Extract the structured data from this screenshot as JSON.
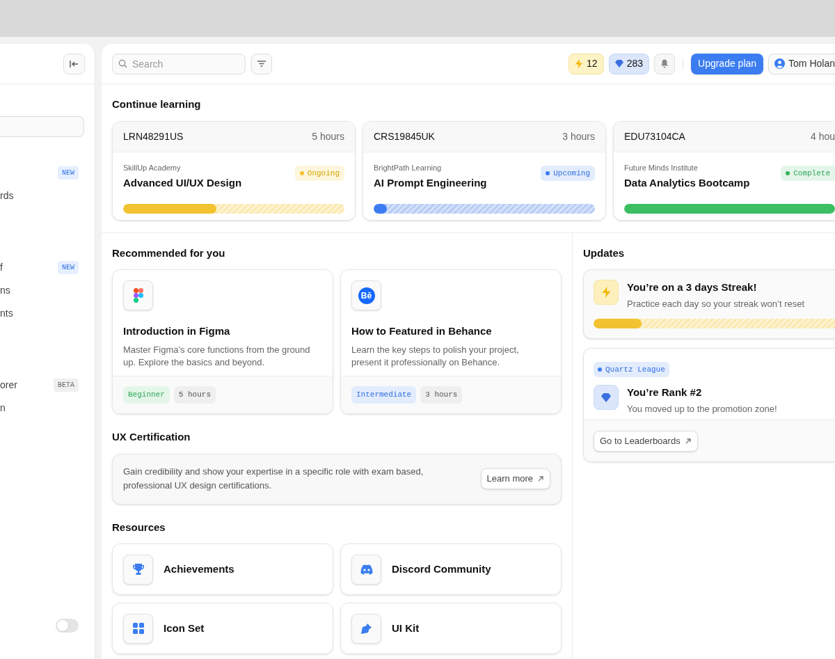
{
  "sidebar": {
    "groups": [
      [
        {
          "badge": {
            "text": "NEW",
            "kind": "new"
          }
        },
        {
          "label": "rds"
        }
      ],
      [
        {
          "label": "f",
          "badge": {
            "text": "NEW",
            "kind": "new"
          }
        },
        {
          "label": "ns"
        },
        {
          "label": "nts"
        }
      ],
      [
        {
          "label": "orer",
          "badge": {
            "text": "BETA",
            "kind": "beta"
          }
        },
        {
          "label": "n"
        }
      ]
    ],
    "toggle": {
      "on": false
    }
  },
  "header": {
    "search": {
      "placeholder": "Search"
    },
    "streak": "12",
    "gems": "283",
    "upgrade": "Upgrade plan",
    "user": "Tom Holan"
  },
  "continue_learning": {
    "title": "Continue learning",
    "cards": [
      {
        "code": "LRN48291US",
        "hours": "5 hours",
        "provider": "SkillUp Academy",
        "title": "Advanced UI/UX Design",
        "status": {
          "text": "Ongoing",
          "kind": "ongoing"
        },
        "level": 0.42
      },
      {
        "code": "CRS19845UK",
        "hours": "3 hours",
        "provider": "BrightPath Learning",
        "title": "AI Prompt Engineering",
        "status": {
          "text": "Upcoming",
          "kind": "upcoming"
        },
        "level": 0.06
      },
      {
        "code": "EDU73104CA",
        "hours": "4 hou",
        "provider": "Future Minds Institute",
        "title": "Data Analytics Bootcamp",
        "status": {
          "text": "Complete",
          "kind": "completed"
        },
        "level": 1
      }
    ]
  },
  "recommended": {
    "title": "Recommended for you",
    "cards": [
      {
        "kind": "figma",
        "title": "Introduction in Figma",
        "description": "Master Figma’s core functions from the ground up. Explore the basics and beyond.",
        "level_tag": {
          "text": "Beginner",
          "kind": "beginner"
        },
        "duration": "5 hours"
      },
      {
        "kind": "behance",
        "logo_text": "Bē",
        "title": "How to Featured in Behance",
        "description": "Learn the key steps to polish your project, present it professionally on Behance.",
        "level_tag": {
          "text": "Intermediate",
          "kind": "intermediate"
        },
        "duration": "3 hours"
      }
    ]
  },
  "certification": {
    "title": "UX Certification",
    "text": "Gain credibility and show your expertise in a specific role with exam based, professional UX design certifications.",
    "button": "Learn more"
  },
  "resources": {
    "title": "Resources",
    "items": [
      {
        "label": "Achievements",
        "kind": "trophy"
      },
      {
        "label": "Discord Community",
        "kind": "chat"
      },
      {
        "label": "Icon Set",
        "kind": "grid"
      },
      {
        "label": "UI Kit",
        "kind": "pen"
      }
    ]
  },
  "updates": {
    "title": "Updates",
    "streak": {
      "title": "You’re on a 3 days Streak!",
      "subtitle": "Practice each day so your streak won’t reset",
      "level": 0.2
    },
    "rank": {
      "league": "Quartz League",
      "title": "You’re Rank #2",
      "subtitle": "You moved up to the promotion zone!",
      "button": "Go to Leaderboards"
    }
  }
}
